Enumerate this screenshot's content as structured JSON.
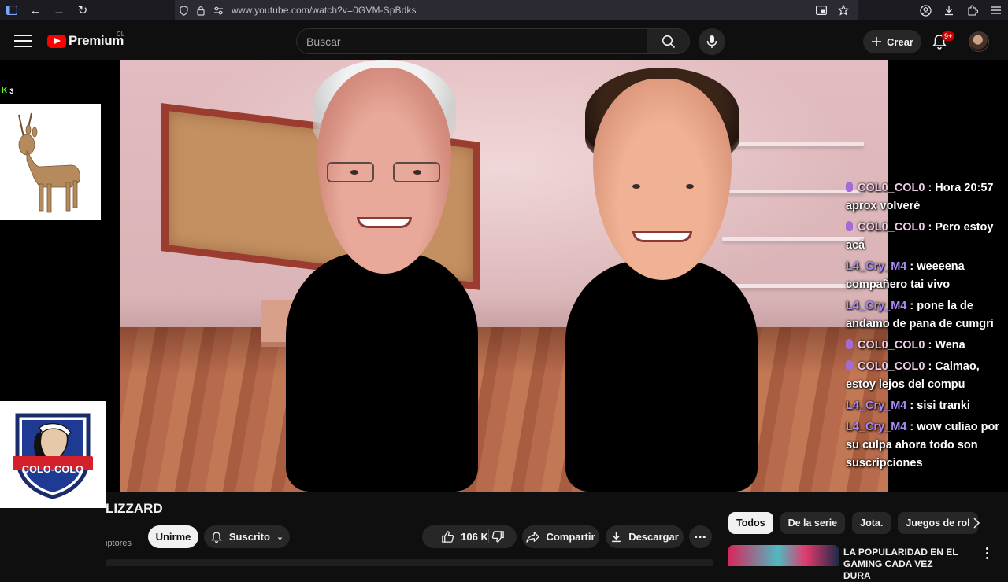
{
  "browser": {
    "url": "www.youtube.com/watch?v=0GVM-SpBdks"
  },
  "header": {
    "logo_text": "Premium",
    "region": "CL",
    "search_placeholder": "Buscar",
    "create_label": "Crear",
    "notification_count": "9+"
  },
  "overlay": {
    "kick_viewers": "3",
    "team_name": "COLO-COLO"
  },
  "chat": [
    {
      "user": "COL0_COL0",
      "type": "colo",
      "text": ": Hora 20:57 aprox volveré"
    },
    {
      "user": "COL0_COL0",
      "type": "colo",
      "text": ": Pero estoy acá"
    },
    {
      "user": "L4_Cry_M4",
      "type": "l4",
      "text": ": weeeena compañero tai vivo"
    },
    {
      "user": "L4_Cry_M4",
      "type": "l4",
      "text": ": pone la de andamo de pana de cumgri"
    },
    {
      "user": "COL0_COL0",
      "type": "colo",
      "text": ": Wena"
    },
    {
      "user": "COL0_COL0",
      "type": "colo",
      "text": ": Calmao, estoy lejos del compu"
    },
    {
      "user": "L4_Cry_M4",
      "type": "l4",
      "text": ": sisi tranki"
    },
    {
      "user": "L4_Cry_M4",
      "type": "l4",
      "text": ": wow culiao por su culpa ahora todo son suscripciones"
    }
  ],
  "video": {
    "title": "LIZZARD",
    "subscribers_partial": "iptores",
    "join_label": "Unirme",
    "subscribed_label": "Suscrito",
    "likes": "106 K",
    "share_label": "Compartir",
    "download_label": "Descargar"
  },
  "chips": [
    "Todos",
    "De la serie",
    "Jota.",
    "Juegos de rol"
  ],
  "recommendation": {
    "title": "LA POPULARIDAD EN EL GAMING CADA VEZ DURA"
  },
  "colors": {
    "yt_red": "#ff0000",
    "chat_colo": "#f0cde6",
    "chat_l4": "#a98bf5",
    "kick_green": "#53fc18"
  }
}
